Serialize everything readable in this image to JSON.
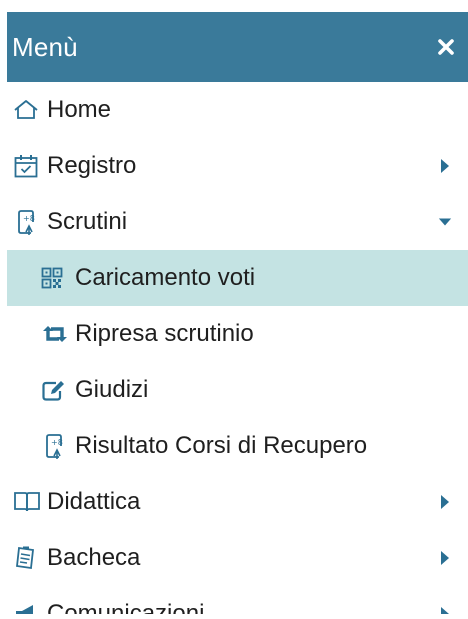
{
  "header": {
    "title": "Menù",
    "close_icon": "close-icon"
  },
  "colors": {
    "header_bg": "#3a7a9a",
    "active_bg": "#c4e3e3",
    "icon_blue": "#2a6f93"
  },
  "items": [
    {
      "label": "Home",
      "icon": "home-icon"
    },
    {
      "label": "Registro",
      "icon": "calendar-check-icon",
      "caret": "caret-right"
    },
    {
      "label": "Scrutini",
      "icon": "grade-document-icon",
      "caret": "caret-down"
    },
    {
      "label": "Caricamento voti",
      "icon": "qr-code-icon",
      "active": true
    },
    {
      "label": "Ripresa scrutinio",
      "icon": "retweet-icon"
    },
    {
      "label": "Giudizi",
      "icon": "edit-icon"
    },
    {
      "label": "Risultato Corsi di Recupero",
      "icon": "grade-document-icon"
    },
    {
      "label": "Didattica",
      "icon": "book-icon",
      "caret": "caret-right"
    },
    {
      "label": "Bacheca",
      "icon": "notice-board-icon",
      "caret": "caret-right"
    },
    {
      "label": "Comunicazioni",
      "icon": "megaphone-icon",
      "caret": "caret-right"
    }
  ]
}
